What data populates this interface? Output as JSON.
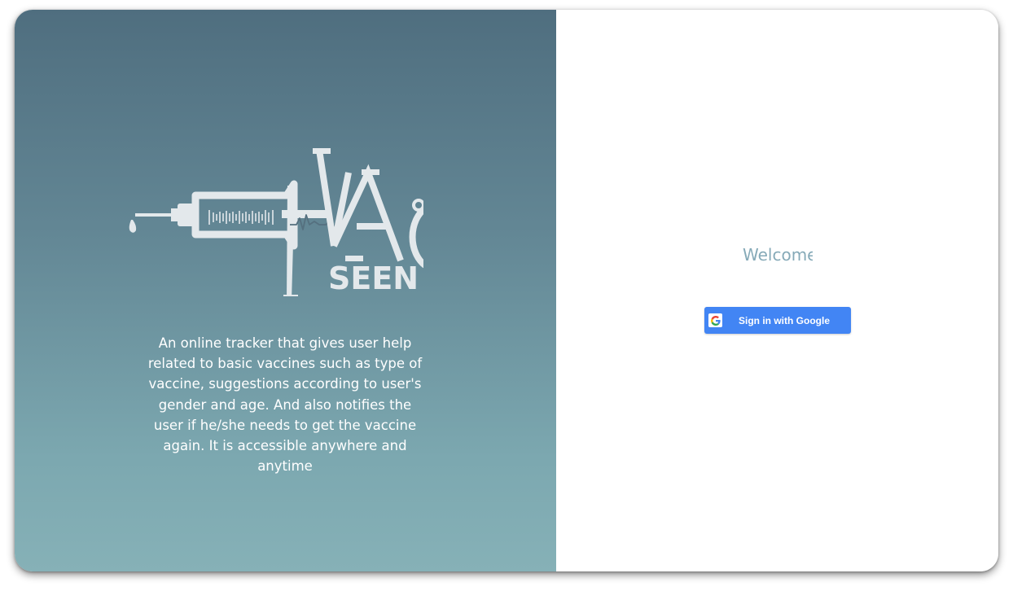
{
  "brand": {
    "logo_letters": "VAC",
    "logo_subword": "SEEN",
    "logo_color": "#e3e8eb"
  },
  "left_panel": {
    "description": "An online tracker that gives user help related to basic vaccines such as type of vaccine, suggestions according to user's gender and age. And also notifies the user if he/she needs to get the vaccine again. It is accessible anywhere and anytime",
    "gradient_top": "#4f6e7f",
    "gradient_bottom": "#86b1b7"
  },
  "right_panel": {
    "welcome_text": "Welcome",
    "welcome_color": "#86aab8",
    "google_button": {
      "label": "Sign in with Google",
      "icon": "google-g-icon",
      "color": "#4285f4"
    }
  }
}
